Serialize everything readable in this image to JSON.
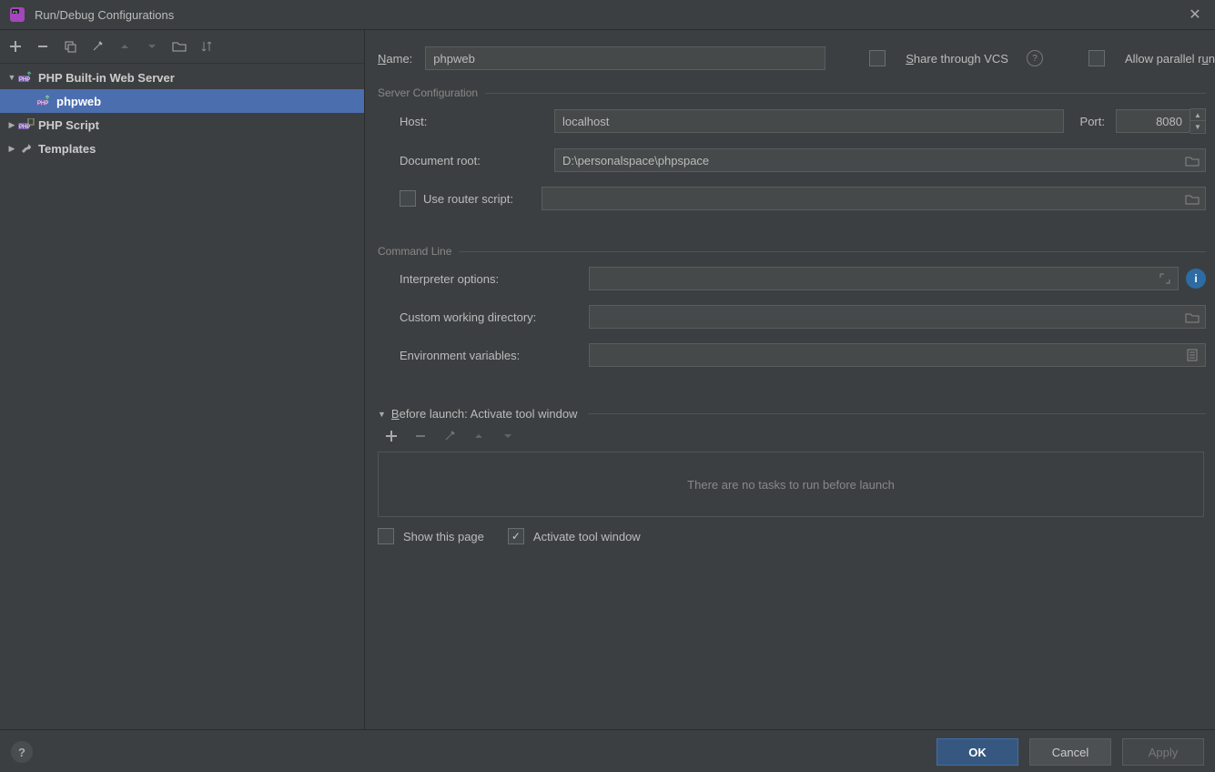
{
  "window": {
    "title": "Run/Debug Configurations"
  },
  "nameRow": {
    "label": "Name:",
    "value": "phpweb",
    "shareLabel": "Share through VCS",
    "allowParallelLabel": "Allow parallel run"
  },
  "tree": {
    "items": [
      {
        "label": "PHP Built-in Web Server",
        "expanded": true,
        "bold": true
      },
      {
        "label": "phpweb",
        "selected": true,
        "indent": 1
      },
      {
        "label": "PHP Script",
        "bold": true,
        "arrow": true
      },
      {
        "label": "Templates",
        "bold": true,
        "arrow": true,
        "icon": "wrench"
      }
    ]
  },
  "server": {
    "title": "Server Configuration",
    "hostLabel": "Host:",
    "hostValue": "localhost",
    "portLabel": "Port:",
    "portValue": "8080",
    "docrootLabel": "Document root:",
    "docrootValue": "D:\\personalspace\\phpspace",
    "routerCbLabel": "Use router script:",
    "routerValue": ""
  },
  "cmd": {
    "title": "Command Line",
    "interpLabel": "Interpreter options:",
    "interpValue": "",
    "cwdLabel": "Custom working directory:",
    "cwdValue": "",
    "envLabel": "Environment variables:",
    "envValue": ""
  },
  "beforeLaunch": {
    "title": "Before launch: Activate tool window",
    "empty": "There are no tasks to run before launch",
    "showThisPage": "Show this page",
    "activateTool": "Activate tool window"
  },
  "buttons": {
    "ok": "OK",
    "cancel": "Cancel",
    "apply": "Apply"
  }
}
